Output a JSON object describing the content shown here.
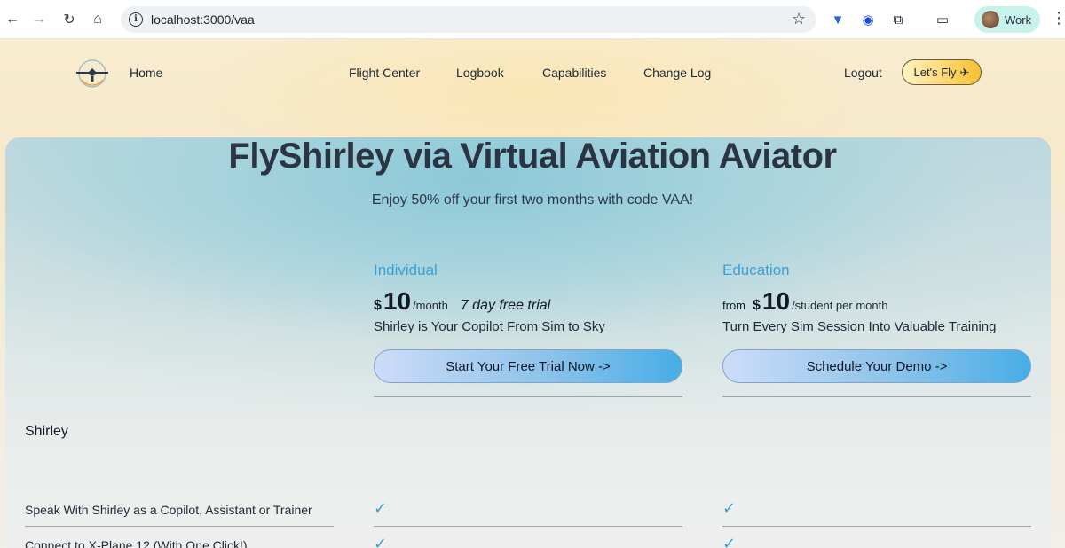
{
  "browser": {
    "url": "localhost:3000/vaa",
    "profile_label": "Work"
  },
  "nav": {
    "home": "Home",
    "flight_center": "Flight Center",
    "logbook": "Logbook",
    "capabilities": "Capabilities",
    "change_log": "Change Log",
    "logout": "Logout",
    "lets_fly": "Let's Fly"
  },
  "hero": {
    "title": "FlyShirley via Virtual Aviation Aviator",
    "subtitle": "Enjoy 50% off your first two months with code VAA!"
  },
  "plans": [
    {
      "name": "Individual",
      "from": "",
      "currency": "$",
      "amount": "10",
      "period": "/month",
      "trial": "7 day free trial",
      "tagline": "Shirley is Your Copilot From Sim to Sky",
      "cta": "Start Your Free Trial Now ->"
    },
    {
      "name": "Education",
      "from": "from",
      "currency": "$",
      "amount": "10",
      "period": "/student per month",
      "trial": "",
      "tagline": "Turn Every Sim Session Into Valuable Training",
      "cta": "Schedule Your Demo ->"
    }
  ],
  "features": {
    "section_title": "Shirley",
    "rows": [
      {
        "label": "Speak With Shirley as a Copilot, Assistant or Trainer",
        "individual": "✓",
        "education": "✓"
      },
      {
        "label": "Connect to X-Plane 12 (With One Click!)",
        "individual": "✓",
        "education": "✓"
      }
    ]
  },
  "colors": {
    "accent_blue": "#3a9fd9",
    "fly_button": "#ffd56a"
  }
}
